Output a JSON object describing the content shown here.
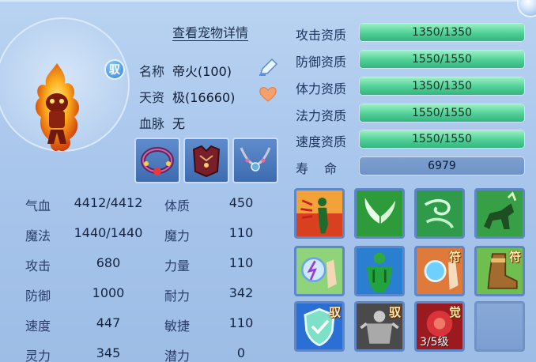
{
  "pet": {
    "detail_link": "查看宠物详情",
    "badge": "驭",
    "name_label": "名称",
    "name_value": "帝火(100)",
    "talent_label": "天资",
    "talent_value": "极(16660)",
    "blood_label": "血脉",
    "blood_value": "无",
    "equipment": [
      "collar-item",
      "armor-item",
      "necklace-item"
    ]
  },
  "stats": [
    {
      "label": "气血",
      "value": "4412/4412"
    },
    {
      "label": "体质",
      "value": "450"
    },
    {
      "label": "魔法",
      "value": "1440/1440"
    },
    {
      "label": "魔力",
      "value": "110"
    },
    {
      "label": "攻击",
      "value": "680"
    },
    {
      "label": "力量",
      "value": "110"
    },
    {
      "label": "防御",
      "value": "1000"
    },
    {
      "label": "耐力",
      "value": "342"
    },
    {
      "label": "速度",
      "value": "447"
    },
    {
      "label": "敏捷",
      "value": "110"
    },
    {
      "label": "灵力",
      "value": "345"
    },
    {
      "label": "潜力",
      "value": "0"
    }
  ],
  "aptitudes": [
    {
      "label": "攻击资质",
      "value": "1350/1350",
      "fill": 1.0
    },
    {
      "label": "防御资质",
      "value": "1550/1550",
      "fill": 1.0
    },
    {
      "label": "体力资质",
      "value": "1350/1350",
      "fill": 1.0
    },
    {
      "label": "法力资质",
      "value": "1550/1550",
      "fill": 1.0
    },
    {
      "label": "速度资质",
      "value": "1550/1550",
      "fill": 1.0
    }
  ],
  "life": {
    "label": "寿命",
    "value": "6979"
  },
  "skills": [
    {
      "icon": "fire-body-icon",
      "tag": "",
      "level": ""
    },
    {
      "icon": "wings-icon",
      "tag": "",
      "level": ""
    },
    {
      "icon": "wind-spirit-icon",
      "tag": "",
      "level": ""
    },
    {
      "icon": "beast-rider-icon",
      "tag": "",
      "level": ""
    },
    {
      "icon": "lightning-palm-icon",
      "tag": "",
      "level": ""
    },
    {
      "icon": "green-giant-icon",
      "tag": "",
      "level": ""
    },
    {
      "icon": "orb-palm-icon",
      "tag": "符",
      "level": ""
    },
    {
      "icon": "boot-icon",
      "tag": "符",
      "level": ""
    },
    {
      "icon": "shield-icon",
      "tag": "驭",
      "level": ""
    },
    {
      "icon": "stone-guardian-icon",
      "tag": "驭",
      "level": ""
    },
    {
      "icon": "red-awaken-icon",
      "tag": "觉",
      "level": "3/5级"
    },
    {
      "icon": "empty-slot",
      "tag": "",
      "level": ""
    }
  ],
  "colors": {
    "bar_fill": "#4fcf96",
    "panel_bg": "#a9c6ec",
    "slot_border": "#5f86c6"
  }
}
